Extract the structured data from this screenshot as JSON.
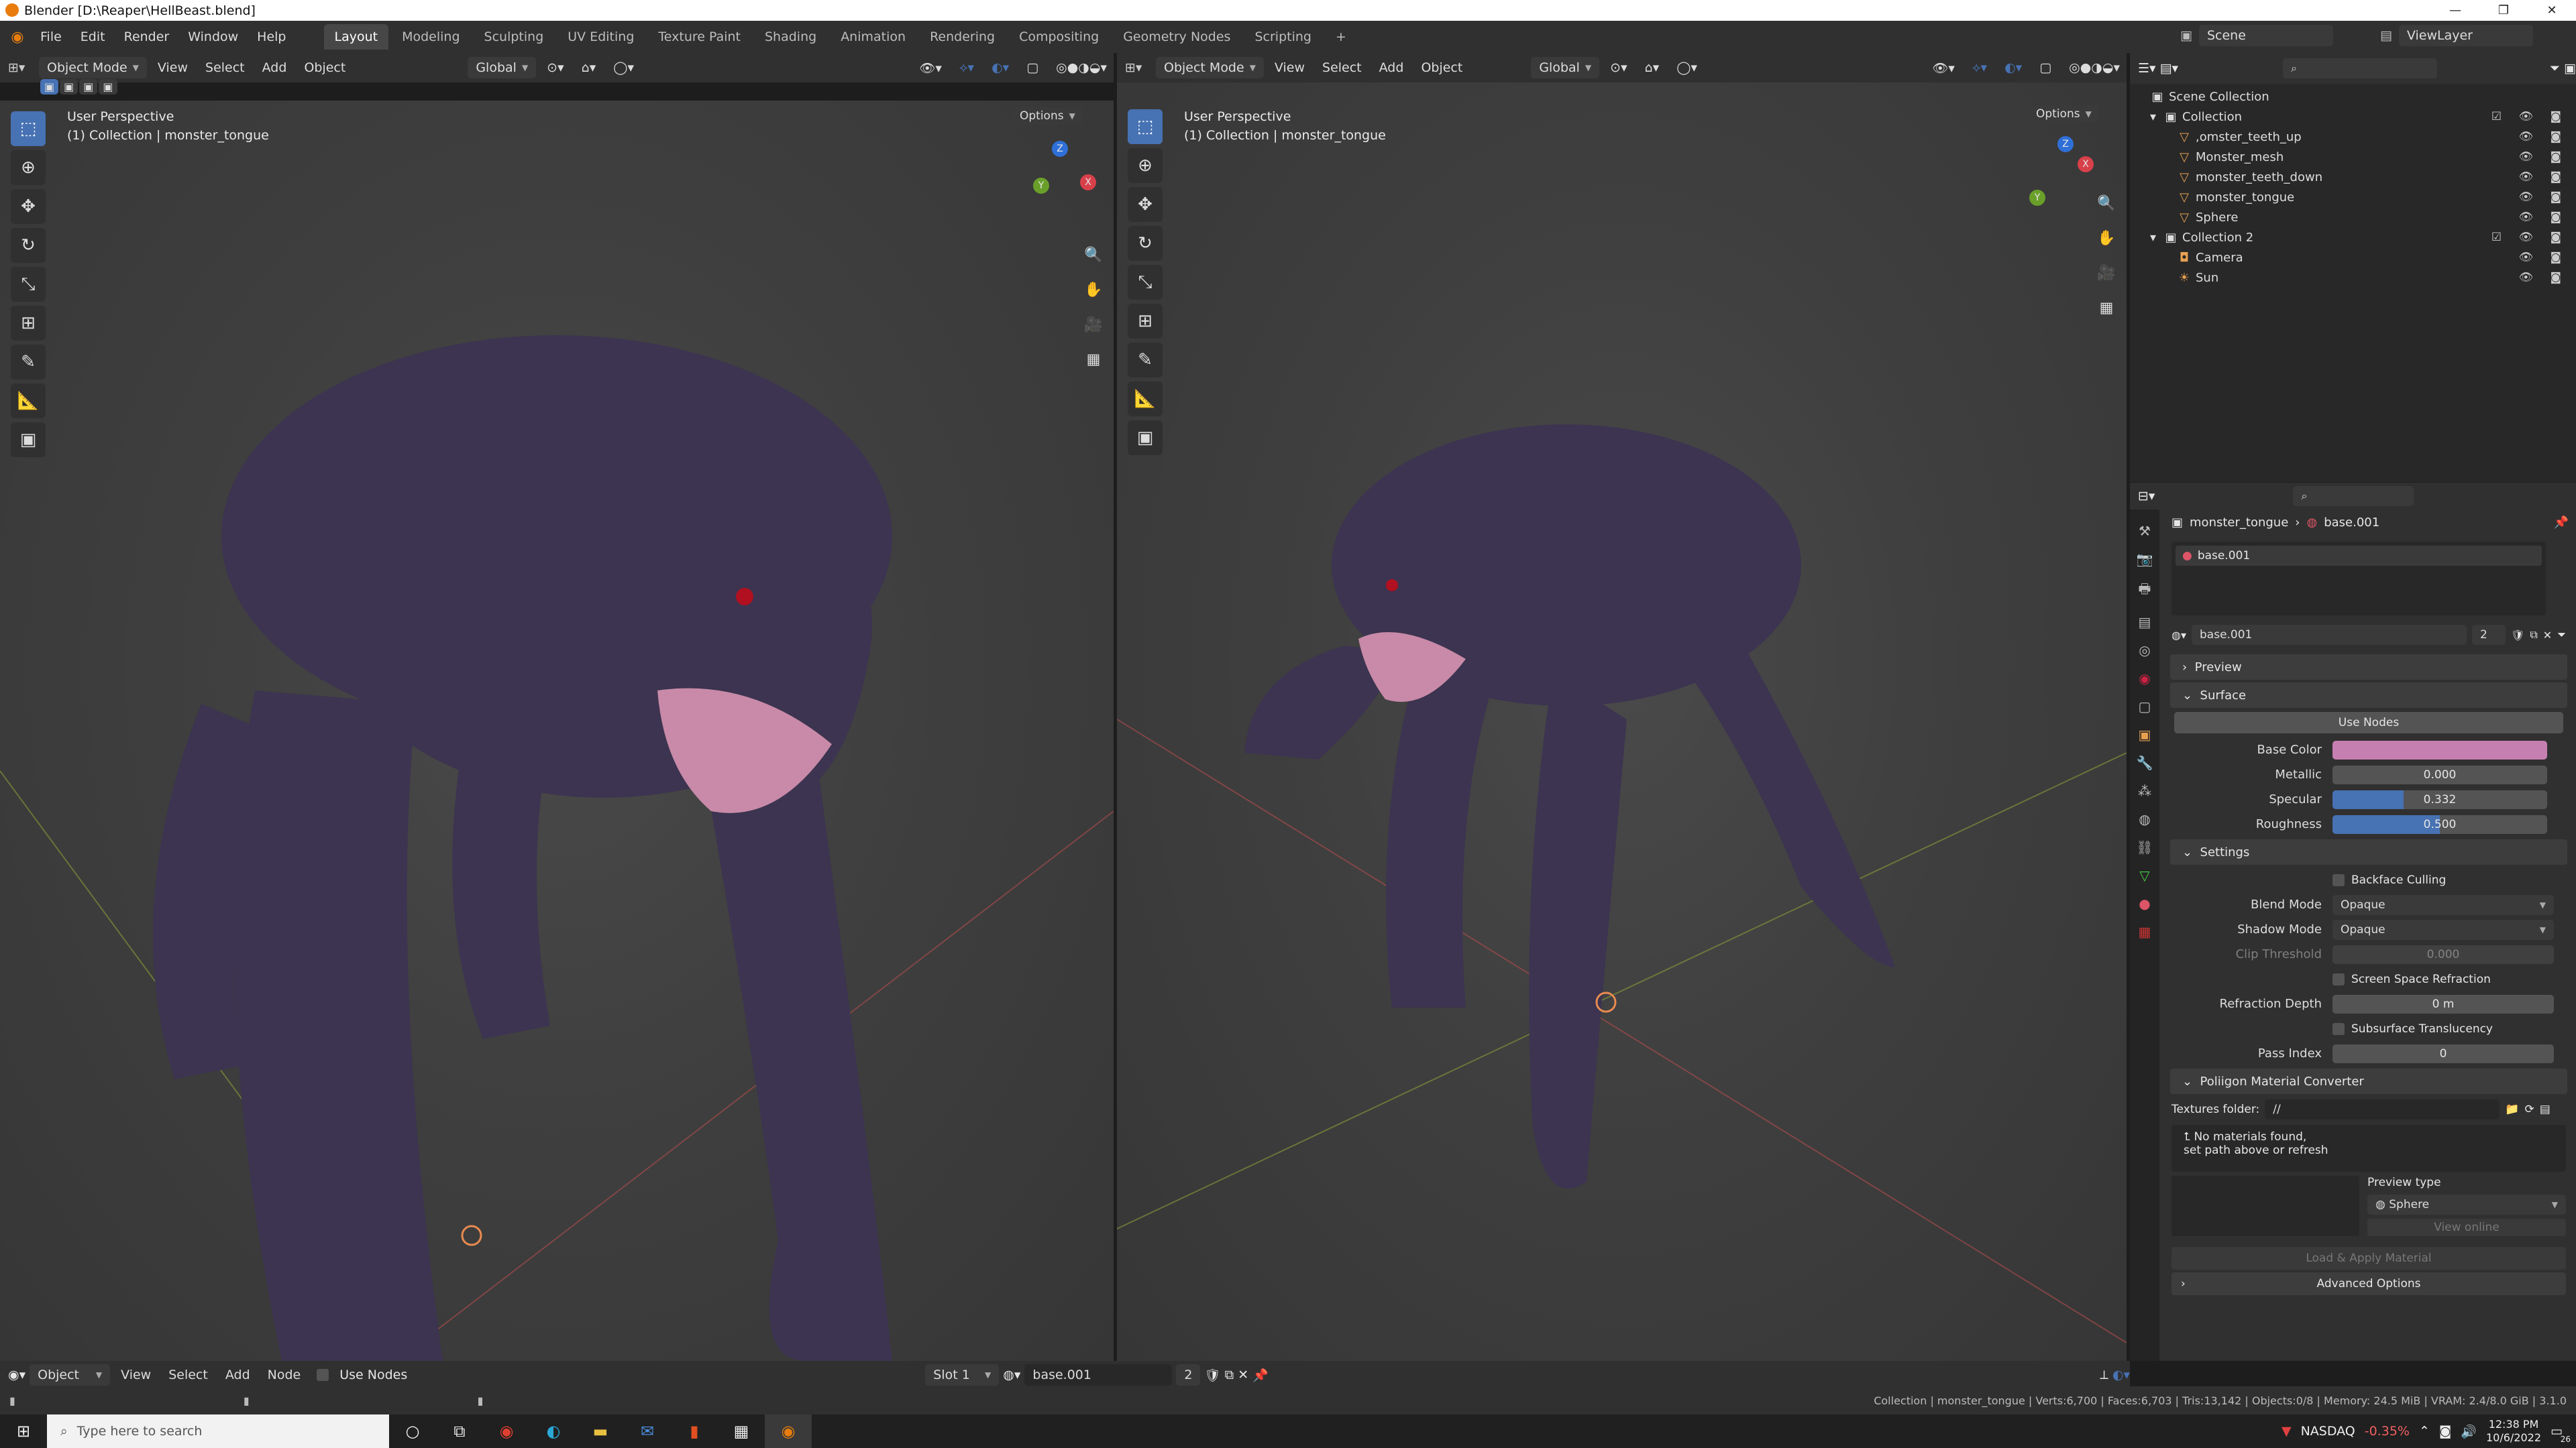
{
  "window": {
    "title": "Blender [D:\\Reaper\\HellBeast.blend]",
    "min": "—",
    "max": "❐",
    "close": "✕"
  },
  "menu": [
    "File",
    "Edit",
    "Render",
    "Window",
    "Help"
  ],
  "workspaces": [
    "Layout",
    "Modeling",
    "Sculpting",
    "UV Editing",
    "Texture Paint",
    "Shading",
    "Animation",
    "Rendering",
    "Compositing",
    "Geometry Nodes",
    "Scripting"
  ],
  "workspace_add": "+",
  "scene": {
    "name": "Scene",
    "view_layer": "ViewLayer"
  },
  "viewport_left": {
    "mode": "Object Mode",
    "menus": [
      "View",
      "Select",
      "Add",
      "Object"
    ],
    "orientation": "Global",
    "options": "Options",
    "label1": "User Perspective",
    "label2": "(1) Collection | monster_tongue"
  },
  "viewport_right": {
    "mode": "Object Mode",
    "menus": [
      "View",
      "Select",
      "Add",
      "Object"
    ],
    "orientation": "Global",
    "options": "Options",
    "label1": "User Perspective",
    "label2": "(1) Collection | monster_tongue"
  },
  "gizmo": {
    "x": "X",
    "y": "Y",
    "z": "Z"
  },
  "outliner": {
    "root": "Scene Collection",
    "collection1": "Collection",
    "items1": [
      ",omster_teeth_up",
      "Monster_mesh",
      "monster_teeth_down",
      "monster_tongue",
      "Sphere"
    ],
    "collection2": "Collection 2",
    "items2": [
      "Camera",
      "Sun"
    ]
  },
  "properties": {
    "breadcrumb_obj": "monster_tongue",
    "breadcrumb_mat": "base.001",
    "slot_name": "base.001",
    "material_name": "base.001",
    "material_users": "2",
    "sections": {
      "preview": "Preview",
      "surface": "Surface",
      "settings": "Settings",
      "poliigon": "Poliigon Material Converter"
    },
    "use_nodes": "Use Nodes",
    "base_color_label": "Base Color",
    "base_color": "#c67fb1",
    "metallic_label": "Metallic",
    "metallic": "0.000",
    "metallic_frac": 0.0,
    "specular_label": "Specular",
    "specular": "0.332",
    "specular_frac": 0.332,
    "roughness_label": "Roughness",
    "roughness": "0.500",
    "roughness_frac": 0.5,
    "backface_culling": "Backface Culling",
    "blend_mode_label": "Blend Mode",
    "blend_mode": "Opaque",
    "shadow_mode_label": "Shadow Mode",
    "shadow_mode": "Opaque",
    "clip_threshold_label": "Clip Threshold",
    "clip_threshold": "0.000",
    "ssr": "Screen Space Refraction",
    "refraction_depth_label": "Refraction Depth",
    "refraction_depth": "0 m",
    "sss": "Subsurface Translucency",
    "pass_index_label": "Pass Index",
    "pass_index": "0",
    "textures_folder_label": "Textures folder:",
    "textures_folder": "//",
    "no_materials_1": "No materials found,",
    "no_materials_2": "set path above or refresh",
    "preview_type_label": "Preview type",
    "preview_type": "Sphere",
    "view_online": "View online",
    "load_apply": "Load & Apply Material",
    "advanced": "Advanced Options"
  },
  "node_header": {
    "editor": "Object",
    "menus": [
      "View",
      "Select",
      "Add",
      "Node"
    ],
    "use_nodes": "Use Nodes",
    "slot": "Slot 1",
    "material": "base.001",
    "users": "2"
  },
  "status_right": "Collection | monster_tongue | Verts:6,700 | Faces:6,703 | Tris:13,142 | Objects:0/8 | Memory: 24.5 MiB | VRAM: 2.4/8.0 GiB | 3.1.0",
  "taskbar": {
    "search_placeholder": "Type here to search",
    "stock_name": "NASDAQ",
    "stock_change": "-0.35%",
    "time": "12:38 PM",
    "date": "10/6/2022",
    "notif": "26"
  },
  "colors": {
    "accent": "#4772b3",
    "creature": "#3c3450",
    "tongue": "#c88aa8"
  }
}
